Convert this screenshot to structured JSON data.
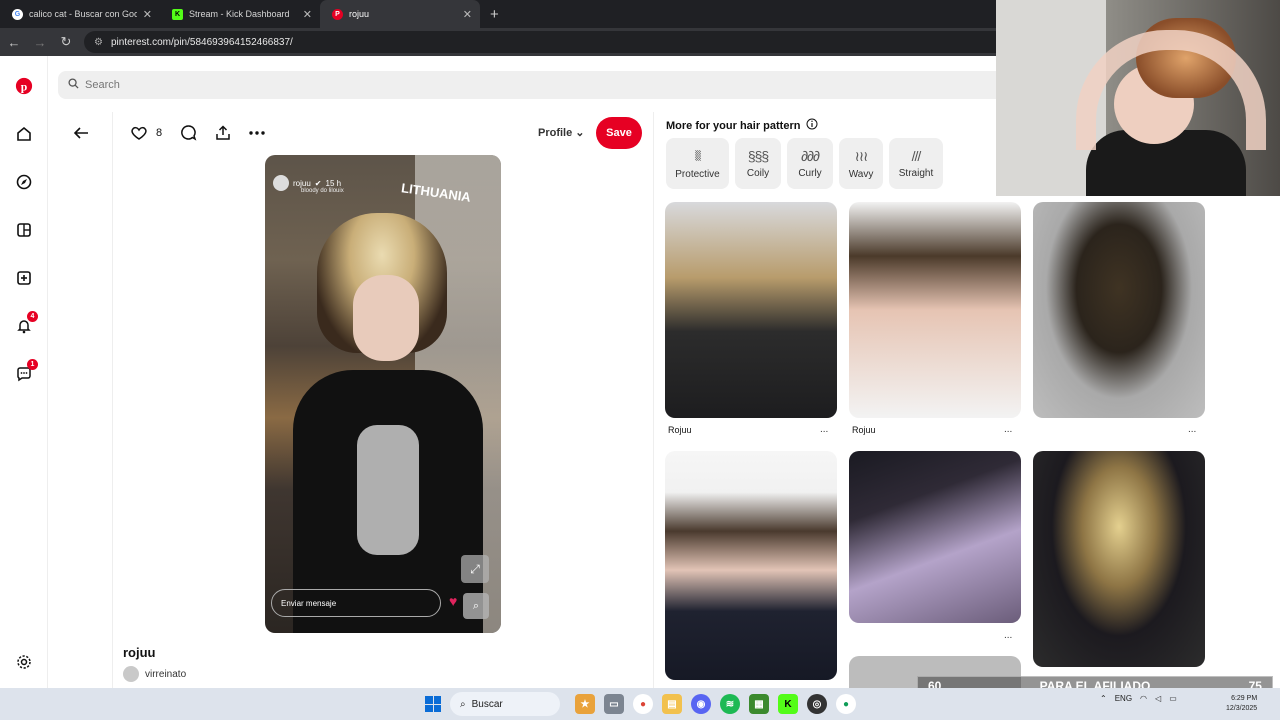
{
  "browser": {
    "tabs": [
      {
        "label": "calico cat - Buscar con Google",
        "favicon": "google-icon",
        "color": "#4285f4",
        "active": false
      },
      {
        "label": "Stream - Kick Dashboard",
        "favicon": "kick-icon",
        "color": "#53fc18",
        "active": false
      },
      {
        "label": "rojuu",
        "favicon": "pinterest-icon",
        "color": "#e60023",
        "active": true
      }
    ],
    "new_tab": "+",
    "url": "pinterest.com/pin/584693964152466837/"
  },
  "rail": {
    "notification_badge": "4",
    "message_badge": "1"
  },
  "search": {
    "placeholder": "Search"
  },
  "pin": {
    "like_count": "8",
    "profile_label": "Profile",
    "save_label": "Save",
    "story": {
      "username": "rojuu",
      "time": "15 h",
      "subtitle": "bloody do lilouix",
      "location": "LITHUANIA",
      "message_placeholder": "Enviar mensaje"
    },
    "title": "rojuu",
    "author": "virreinato"
  },
  "related": {
    "title": "More for your hair pattern",
    "patterns": [
      {
        "label": "Protective",
        "glyph": "⦚⦚⦚"
      },
      {
        "label": "Coily",
        "glyph": "§§§"
      },
      {
        "label": "Curly",
        "glyph": "∂∂∂"
      },
      {
        "label": "Wavy",
        "glyph": "≀≀≀"
      },
      {
        "label": "Straight",
        "glyph": "///"
      }
    ],
    "captions": [
      "Rojuu",
      "Rojuu"
    ],
    "more": "..."
  },
  "overlay": {
    "affiliate_left": "60",
    "affiliate_label": "PARA EL AFILIADO",
    "affiliate_right": "75"
  },
  "taskbar": {
    "search_label": "Buscar",
    "lang": "ENG",
    "time": "6:29 PM",
    "date": "12/3/2025"
  }
}
